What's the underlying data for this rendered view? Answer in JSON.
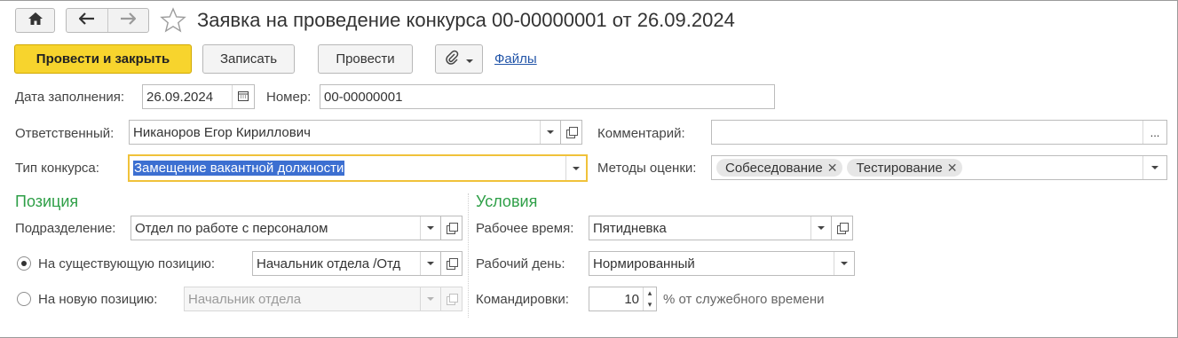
{
  "window": {
    "title": "Заявка на проведение конкурса 00-00000001 от 26.09.2024"
  },
  "toolbar": {
    "post_and_close": "Провести и закрыть",
    "save": "Записать",
    "post": "Провести",
    "files_link": "Файлы"
  },
  "header": {
    "date_label": "Дата заполнения:",
    "date_value": "26.09.2024",
    "number_label": "Номер:",
    "number_value": "00-00000001",
    "responsible_label": "Ответственный:",
    "responsible_value": "Никаноров Егор Кириллович",
    "comment_label": "Комментарий:",
    "comment_value": "",
    "comment_button": "...",
    "contest_type_label": "Тип конкурса:",
    "contest_type_value": "Замещение вакантной должности",
    "methods_label": "Методы оценки:",
    "methods": [
      "Собеседование",
      "Тестирование"
    ]
  },
  "position": {
    "heading": "Позиция",
    "department_label": "Подразделение:",
    "department_value": "Отдел по работе с персоналом",
    "existing_label": "На существующую позицию:",
    "existing_value": "Начальник отдела /Отд",
    "new_label": "На новую позицию:",
    "new_value": "Начальник отдела",
    "selected_option": "existing"
  },
  "conditions": {
    "heading": "Условия",
    "work_time_label": "Рабочее время:",
    "work_time_value": "Пятидневка",
    "work_day_label": "Рабочий день:",
    "work_day_value": "Нормированный",
    "trips_label": "Командировки:",
    "trips_value": "10",
    "trips_suffix": "% от служебного времени"
  },
  "icons": {
    "home": "home-icon",
    "back": "arrow-left-icon",
    "forward": "arrow-right-icon",
    "favorite": "star-icon",
    "attach": "paperclip-icon",
    "calendar": "calendar-icon"
  },
  "colors": {
    "primary_button": "#f7d42d",
    "section_heading": "#2e9f47",
    "link": "#2154a8",
    "selection": "#3c6fd1",
    "focus_border": "#f0c23a"
  }
}
